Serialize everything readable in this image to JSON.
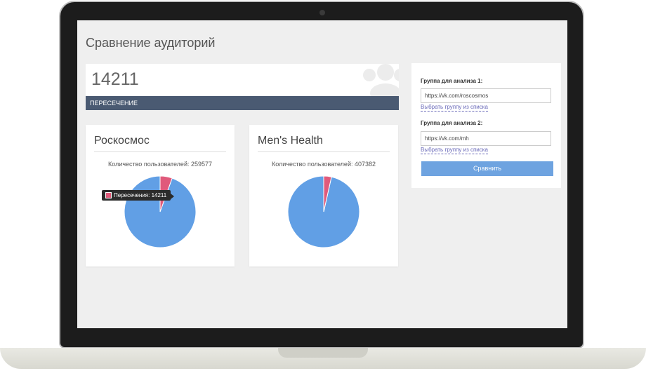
{
  "page": {
    "title": "Сравнение аудиторий"
  },
  "intersection": {
    "value": "14211",
    "label": "ПЕРЕСЕЧЕНИЕ"
  },
  "groups": [
    {
      "name": "Роскосмос",
      "count_text": "Количество пользователей: 259577",
      "users": 259577,
      "intersection": 14211,
      "tooltip": "Пересечения: 14211"
    },
    {
      "name": "Men's Health",
      "count_text": "Количество пользователей: 407382",
      "users": 407382,
      "intersection": 14211
    }
  ],
  "form": {
    "group1_label": "Группа для анализа 1:",
    "group1_value": "https://vk.com/roscosmos",
    "group2_label": "Группа для анализа 2:",
    "group2_value": "https://vk.com/mh",
    "pick_link": "Выбрать группу из списка",
    "submit": "Сравнить"
  },
  "colors": {
    "pie_main": "#619fe5",
    "pie_intersection": "#e05a7b",
    "header_bar": "#4a5a72",
    "button": "#6ea3e0"
  },
  "icons": {
    "background": "users-icon"
  }
}
